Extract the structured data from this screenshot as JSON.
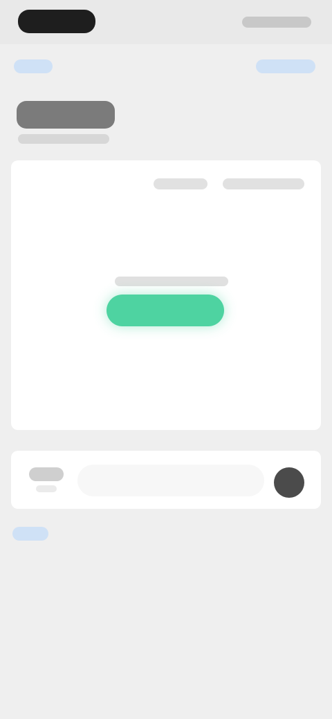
{
  "status_bar": {
    "time": "",
    "icons": ""
  },
  "nav": {
    "left_label": "",
    "right_label": ""
  },
  "page": {
    "title": "",
    "subtitle": ""
  },
  "card": {
    "toolbar_left": "",
    "toolbar_right": "",
    "green_label": "",
    "green_button_label": ""
  },
  "bottom": {
    "left_label": "",
    "left_sublabel": "",
    "input_placeholder": ""
  },
  "footer": {
    "link_label": ""
  },
  "colors": {
    "background": "#efefef",
    "card": "#ffffff",
    "accent_green": "#4ed3a1",
    "link_blue": "#8fb6e6"
  }
}
